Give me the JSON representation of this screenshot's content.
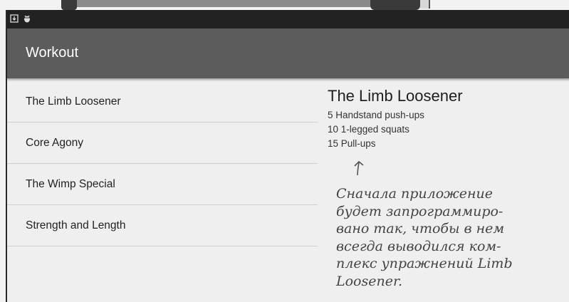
{
  "app": {
    "title": "Workout"
  },
  "status_bar": {
    "icons": [
      "download-icon",
      "android-debug-icon"
    ]
  },
  "workout_list": [
    {
      "label": "The Limb Loosener"
    },
    {
      "label": "Core Agony"
    },
    {
      "label": "The Wimp Special"
    },
    {
      "label": "Strength and Length"
    }
  ],
  "detail": {
    "title": "The Limb Loosener",
    "exercises": [
      "5 Handstand push-ups",
      "10 1-legged squats",
      "15 Pull-ups"
    ]
  },
  "annotation": {
    "lines": [
      "Сначала приложение",
      "будет запрограммиро-",
      "вано так, чтобы в нем",
      "всегда выводился ком-",
      "плекс упражнений Limb",
      "Loosener."
    ]
  }
}
